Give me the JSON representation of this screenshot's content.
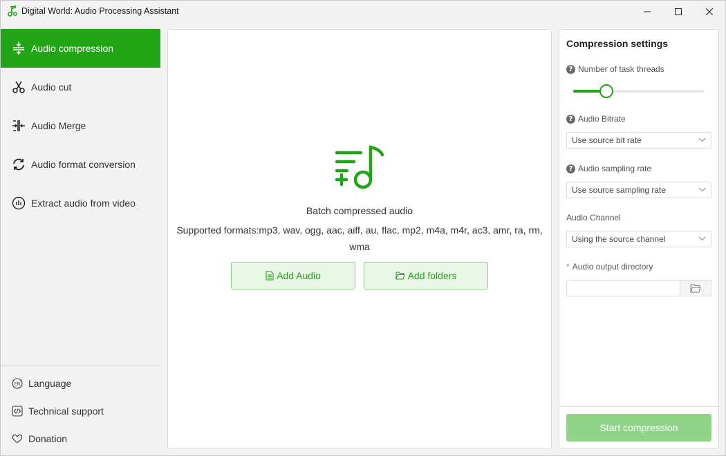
{
  "window": {
    "title": "Digital World: Audio Processing Assistant"
  },
  "sidebar": {
    "items": [
      {
        "label": "Audio compression",
        "icon": "compress-icon",
        "active": true
      },
      {
        "label": "Audio cut",
        "icon": "scissors-icon",
        "active": false
      },
      {
        "label": "Audio Merge",
        "icon": "merge-icon",
        "active": false
      },
      {
        "label": "Audio format conversion",
        "icon": "convert-icon",
        "active": false
      },
      {
        "label": "Extract audio from video",
        "icon": "extract-audio-icon",
        "active": false
      }
    ],
    "footer": [
      {
        "label": "Language",
        "icon": "language-icon"
      },
      {
        "label": "Technical support",
        "icon": "code-icon"
      },
      {
        "label": "Donation",
        "icon": "heart-icon"
      }
    ]
  },
  "main": {
    "heading": "Batch compressed audio",
    "formats": "Supported formats:mp3, wav, ogg, aac, aiff, au, flac, mp2, m4a, m4r, ac3, amr, ra, rm, wma",
    "add_audio_label": "Add Audio",
    "add_folders_label": "Add folders"
  },
  "settings": {
    "title": "Compression settings",
    "threads_label": "Number of task threads",
    "threads_slider_level": 0.25,
    "bitrate_label": "Audio Bitrate",
    "bitrate_value": "Use source bit rate",
    "sampling_label": "Audio sampling rate",
    "sampling_value": "Use source sampling rate",
    "channel_label": "Audio Channel",
    "channel_value": "Using the source channel",
    "output_label": "Audio output directory",
    "output_value": "",
    "start_label": "Start compression"
  },
  "colors": {
    "accent": "#21a415",
    "accent_light": "#e9f6e8",
    "start_disabled": "#90d48a"
  }
}
